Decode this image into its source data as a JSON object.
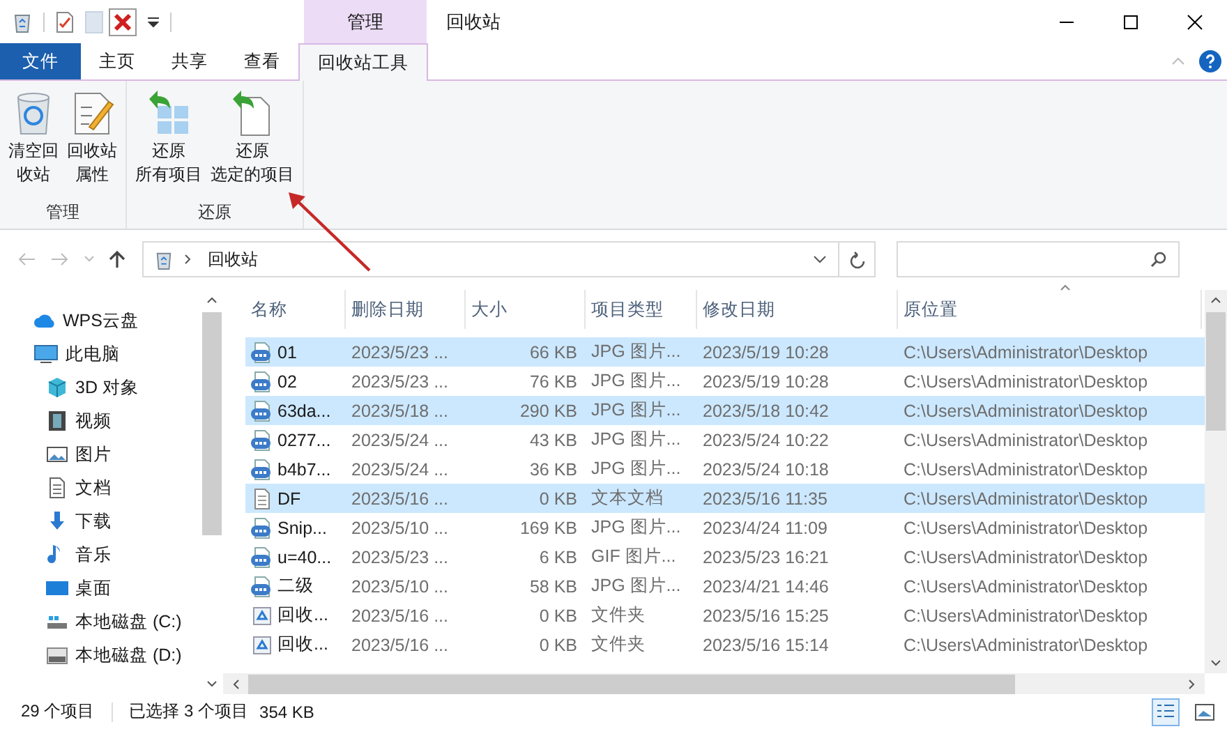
{
  "window": {
    "title": "回收站",
    "context_tab": "管理"
  },
  "ribbon_tabs": [
    {
      "label": "文件",
      "kind": "file",
      "selected": false
    },
    {
      "label": "主页",
      "kind": "tab",
      "selected": false
    },
    {
      "label": "共享",
      "kind": "tab",
      "selected": false
    },
    {
      "label": "查看",
      "kind": "tab",
      "selected": false
    },
    {
      "label": "回收站工具",
      "kind": "tab",
      "selected": true
    }
  ],
  "ribbon_groups": [
    {
      "label": "管理",
      "buttons": [
        {
          "kind": "empty-bin",
          "lines": [
            "清空回",
            "收站"
          ]
        },
        {
          "kind": "properties",
          "lines": [
            "回收站",
            "属性"
          ]
        }
      ]
    },
    {
      "label": "还原",
      "buttons": [
        {
          "kind": "restore-all",
          "lines": [
            "还原",
            "所有项目"
          ]
        },
        {
          "kind": "restore-selected",
          "lines": [
            "还原",
            "选定的项目"
          ]
        }
      ]
    }
  ],
  "annotation": {
    "kind": "arrow"
  },
  "address": {
    "crumb": "回收站"
  },
  "nav": [
    {
      "label": "WPS云盘",
      "kind": "cloud"
    },
    {
      "label": "此电脑",
      "kind": "pc",
      "children": [
        {
          "label": "3D 对象",
          "kind": "cube"
        },
        {
          "label": "视频",
          "kind": "video"
        },
        {
          "label": "图片",
          "kind": "picture"
        },
        {
          "label": "文档",
          "kind": "doc"
        },
        {
          "label": "下载",
          "kind": "download"
        },
        {
          "label": "音乐",
          "kind": "music"
        },
        {
          "label": "桌面",
          "kind": "desktop"
        },
        {
          "label": "本地磁盘 (C:)",
          "kind": "drive-c"
        },
        {
          "label": "本地磁盘 (D:)",
          "kind": "drive"
        }
      ]
    }
  ],
  "table": {
    "columns": [
      "名称",
      "删除日期",
      "大小",
      "项目类型",
      "修改日期",
      "原位置"
    ],
    "rows": [
      {
        "kind": "jpg",
        "selected": true,
        "cells": [
          "01",
          "2023/5/23 ...",
          "66 KB",
          "JPG 图片...",
          "2023/5/19 10:28",
          "C:\\Users\\Administrator\\Desktop"
        ]
      },
      {
        "kind": "jpg",
        "selected": false,
        "cells": [
          "02",
          "2023/5/23 ...",
          "76 KB",
          "JPG 图片...",
          "2023/5/19 10:28",
          "C:\\Users\\Administrator\\Desktop"
        ]
      },
      {
        "kind": "jpg",
        "selected": true,
        "cells": [
          "63da...",
          "2023/5/18 ...",
          "290 KB",
          "JPG 图片...",
          "2023/5/18 10:42",
          "C:\\Users\\Administrator\\Desktop"
        ]
      },
      {
        "kind": "jpg",
        "selected": false,
        "cells": [
          "0277...",
          "2023/5/24 ...",
          "43 KB",
          "JPG 图片...",
          "2023/5/24 10:22",
          "C:\\Users\\Administrator\\Desktop"
        ]
      },
      {
        "kind": "jpg",
        "selected": false,
        "cells": [
          "b4b7...",
          "2023/5/24 ...",
          "36 KB",
          "JPG 图片...",
          "2023/5/24 10:18",
          "C:\\Users\\Administrator\\Desktop"
        ]
      },
      {
        "kind": "txt",
        "selected": true,
        "cells": [
          "DF",
          "2023/5/16 ...",
          "0 KB",
          "文本文档",
          "2023/5/16 11:35",
          "C:\\Users\\Administrator\\Desktop"
        ]
      },
      {
        "kind": "jpg",
        "selected": false,
        "cells": [
          "Snip...",
          "2023/5/10 ...",
          "169 KB",
          "JPG 图片...",
          "2023/4/24 11:09",
          "C:\\Users\\Administrator\\Desktop"
        ]
      },
      {
        "kind": "gif",
        "selected": false,
        "cells": [
          "u=40...",
          "2023/5/23 ...",
          "6 KB",
          "GIF 图片...",
          "2023/5/23 16:21",
          "C:\\Users\\Administrator\\Desktop"
        ]
      },
      {
        "kind": "jpg",
        "selected": false,
        "cells": [
          "二级",
          "2023/5/10 ...",
          "58 KB",
          "JPG 图片...",
          "2023/4/21 14:46",
          "C:\\Users\\Administrator\\Desktop"
        ]
      },
      {
        "kind": "bin-folder",
        "selected": false,
        "cells": [
          "回收...",
          "2023/5/16 ...",
          "0 KB",
          "文件夹",
          "2023/5/16 15:25",
          "C:\\Users\\Administrator\\Desktop"
        ]
      },
      {
        "kind": "bin-folder",
        "selected": false,
        "cells": [
          "回收...",
          "2023/5/16 ...",
          "0 KB",
          "文件夹",
          "2023/5/16 15:14",
          "C:\\Users\\Administrator\\Desktop"
        ]
      }
    ]
  },
  "status_bar": {
    "count": "29 个项目",
    "selection": "已选择 3 个项目",
    "size": "354 KB"
  },
  "view_modes": [
    {
      "kind": "details",
      "selected": true
    },
    {
      "kind": "tiles",
      "selected": false
    }
  ]
}
